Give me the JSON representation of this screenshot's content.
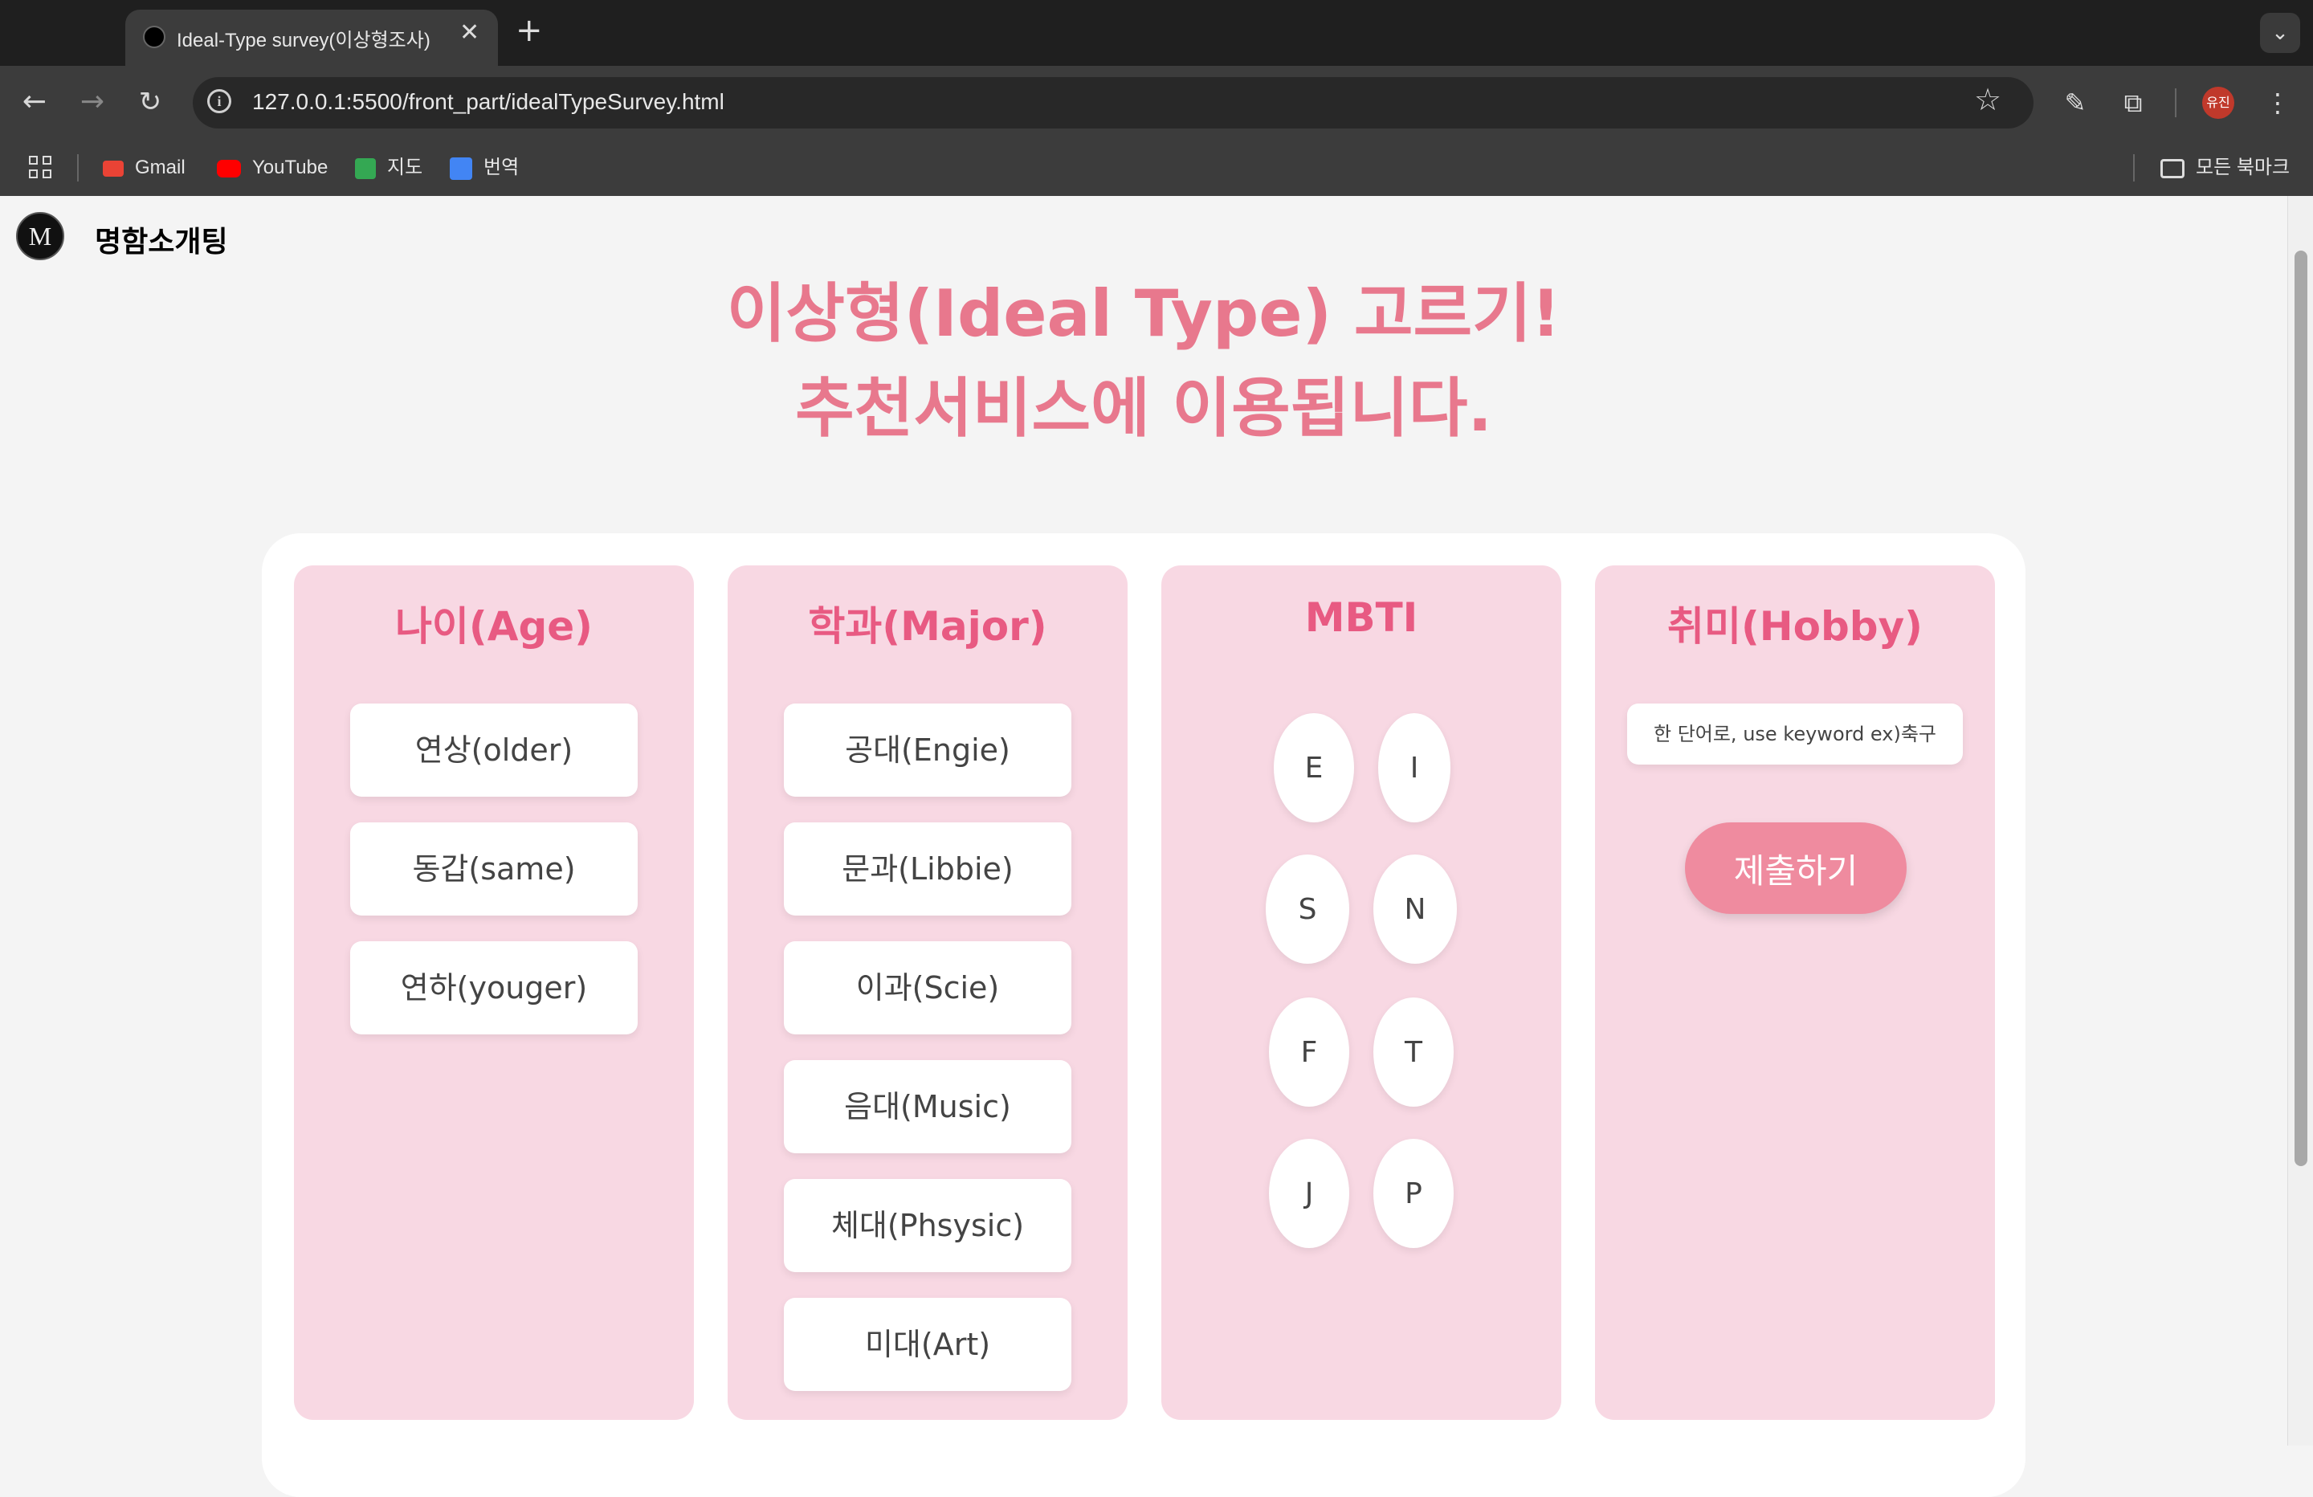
{
  "browser": {
    "tab_title": "Ideal-Type survey(이상형조사)",
    "url": "127.0.0.1:5500/front_part/idealTypeSurvey.html",
    "profile_label": "유진",
    "bookmarks": [
      {
        "label": "Gmail",
        "icon": "gmail-icon",
        "color": "#ea4335"
      },
      {
        "label": "YouTube",
        "icon": "youtube-icon",
        "color": "#ff0000"
      },
      {
        "label": "지도",
        "icon": "maps-icon",
        "color": "#34a853"
      },
      {
        "label": "번역",
        "icon": "translate-icon",
        "color": "#4285f4"
      }
    ],
    "all_bookmarks": "모든 북마크"
  },
  "page": {
    "brand": "명함소개팅",
    "headline_line1": "이상형(Ideal Type) 고르기!",
    "headline_line2": "추천서비스에 이용됩니다.",
    "accent_color": "#e8788d",
    "columns": {
      "age": {
        "title": "나이(Age)",
        "options": [
          "연상(older)",
          "동갑(same)",
          "연하(youger)"
        ]
      },
      "major": {
        "title": "학과(Major)",
        "options": [
          "공대(Engie)",
          "문과(Libbie)",
          "이과(Scie)",
          "음대(Music)",
          "체대(Phsysic)",
          "미대(Art)"
        ]
      },
      "mbti": {
        "title": "MBTI",
        "letters": [
          "E",
          "I",
          "S",
          "N",
          "F",
          "T",
          "J",
          "P"
        ]
      },
      "hobby": {
        "title": "취미(Hobby)",
        "placeholder": "한 단어로, use keyword ex)축구",
        "submit_label": "제출하기"
      }
    }
  }
}
